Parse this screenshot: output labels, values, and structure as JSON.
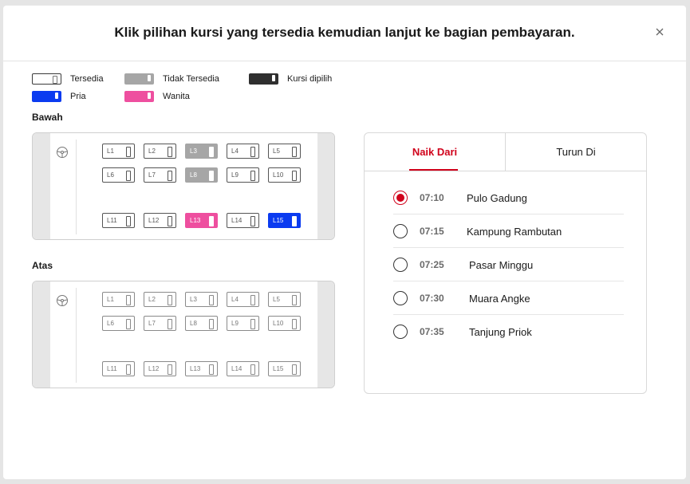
{
  "modal": {
    "title": "Klik pilihan kursi yang tersedia kemudian lanjut ke bagian pembayaran.",
    "close_icon": "close-icon"
  },
  "legend": {
    "available": "Tersedia",
    "unavailable": "Tidak Tersedia",
    "selected": "Kursi dipilih",
    "male": "Pria",
    "female": "Wanita"
  },
  "colors": {
    "accent": "#d0021b",
    "unavailable": "#a6a6a6",
    "selected": "#2f2f2f",
    "male": "#0b3bf0",
    "female": "#ee4f9f"
  },
  "decks": {
    "lower": {
      "label": "Bawah",
      "seats": [
        {
          "code": "L1",
          "status": "available"
        },
        {
          "code": "L2",
          "status": "available"
        },
        {
          "code": "L3",
          "status": "unavailable"
        },
        {
          "code": "L4",
          "status": "available"
        },
        {
          "code": "L5",
          "status": "available"
        },
        {
          "code": "L6",
          "status": "available"
        },
        {
          "code": "L7",
          "status": "available"
        },
        {
          "code": "L8",
          "status": "unavailable"
        },
        {
          "code": "L9",
          "status": "available"
        },
        {
          "code": "L10",
          "status": "available"
        },
        {
          "code": "L11",
          "status": "available"
        },
        {
          "code": "L12",
          "status": "available"
        },
        {
          "code": "L13",
          "status": "female"
        },
        {
          "code": "L14",
          "status": "available"
        },
        {
          "code": "L15",
          "status": "male"
        }
      ]
    },
    "upper": {
      "label": "Atas",
      "seats": [
        {
          "code": "L1",
          "status": "available"
        },
        {
          "code": "L2",
          "status": "available"
        },
        {
          "code": "L3",
          "status": "available"
        },
        {
          "code": "L4",
          "status": "available"
        },
        {
          "code": "L5",
          "status": "available"
        },
        {
          "code": "L6",
          "status": "available"
        },
        {
          "code": "L7",
          "status": "available"
        },
        {
          "code": "L8",
          "status": "available"
        },
        {
          "code": "L9",
          "status": "available"
        },
        {
          "code": "L10",
          "status": "available"
        },
        {
          "code": "L11",
          "status": "available"
        },
        {
          "code": "L12",
          "status": "available"
        },
        {
          "code": "L13",
          "status": "available"
        },
        {
          "code": "L14",
          "status": "available"
        },
        {
          "code": "L15",
          "status": "available"
        }
      ]
    }
  },
  "panel": {
    "tabs": [
      {
        "label": "Naik Dari",
        "active": true
      },
      {
        "label": "Turun Di",
        "active": false
      }
    ],
    "stops": [
      {
        "time": "07:10",
        "place": "Pulo Gadung",
        "selected": true
      },
      {
        "time": "07:15",
        "place": "Kampung Rambutan",
        "selected": false
      },
      {
        "time": "07:25",
        "place": "Pasar Minggu",
        "selected": false
      },
      {
        "time": "07:30",
        "place": "Muara Angke",
        "selected": false
      },
      {
        "time": "07:35",
        "place": "Tanjung Priok",
        "selected": false
      }
    ]
  }
}
